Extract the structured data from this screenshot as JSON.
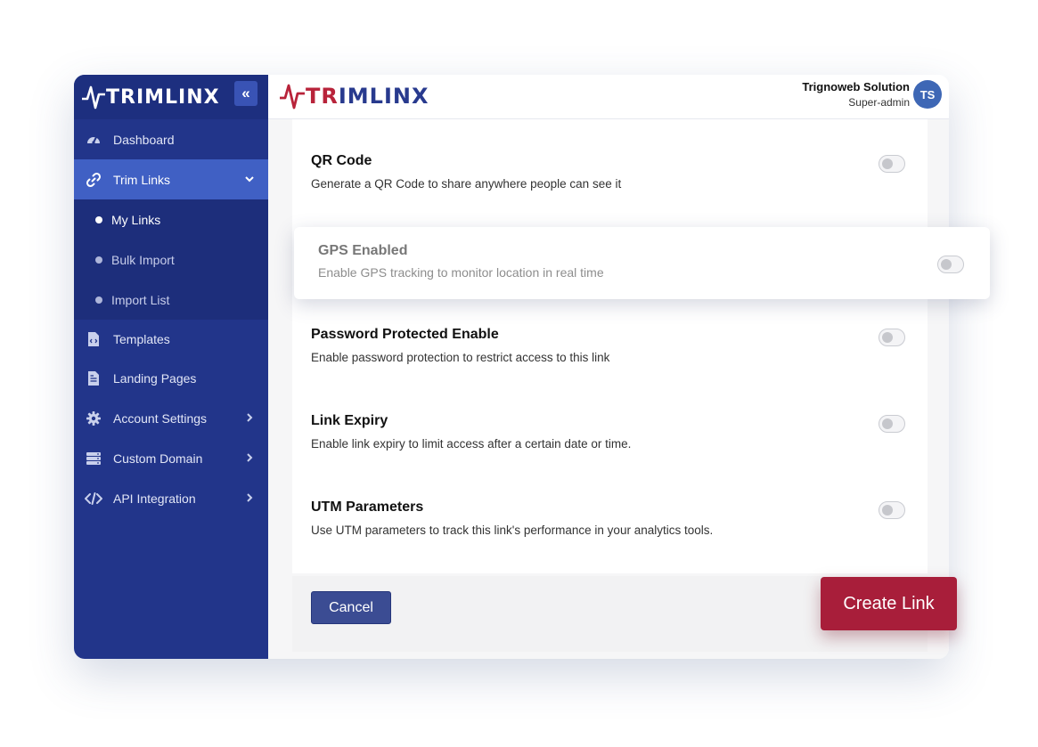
{
  "brand": {
    "name": "TRIMLINX",
    "parts": [
      "TR",
      "I",
      "MLINX"
    ],
    "colors": {
      "sidebar": "#22358a",
      "active": "#4060c4",
      "accent_red": "#a81e3a",
      "brand_red": "#b8233a",
      "brand_navy": "#283a8e"
    }
  },
  "sidebar": {
    "collapse_icon": "double-chevron-left-icon",
    "collapse_glyph": "«",
    "items": [
      {
        "label": "Dashboard",
        "icon": "gauge-icon"
      },
      {
        "label": "Trim Links",
        "icon": "link-icon",
        "active": true,
        "expanded": true
      },
      {
        "label": "Templates",
        "icon": "file-code-icon"
      },
      {
        "label": "Landing Pages",
        "icon": "file-text-icon"
      },
      {
        "label": "Account Settings",
        "icon": "gear-icon"
      },
      {
        "label": "Custom Domain",
        "icon": "server-icon"
      },
      {
        "label": "API Integration",
        "icon": "code-icon"
      }
    ],
    "sub_items": [
      {
        "label": "My Links",
        "current": true
      },
      {
        "label": "Bulk Import"
      },
      {
        "label": "Import List"
      }
    ]
  },
  "header": {
    "user_name": "Trignoweb Solution",
    "user_role": "Super-admin",
    "avatar_initials": "TS"
  },
  "settings": [
    {
      "title": "QR Code",
      "description": "Generate a QR Code to share anywhere people can see it",
      "enabled": false
    },
    {
      "title": "GPS Enabled",
      "description": "Enable GPS tracking to monitor location in real time",
      "enabled": false,
      "highlighted": true
    },
    {
      "title": "Password Protected Enable",
      "description": "Enable password protection to restrict access to this link",
      "enabled": false
    },
    {
      "title": "Link Expiry",
      "description": "Enable link expiry to limit access after a certain date or time.",
      "enabled": false
    },
    {
      "title": "UTM Parameters",
      "description": "Use UTM parameters to track this link's performance in your analytics tools.",
      "enabled": false
    }
  ],
  "actions": {
    "cancel_label": "Cancel",
    "create_label": "Create Link"
  }
}
